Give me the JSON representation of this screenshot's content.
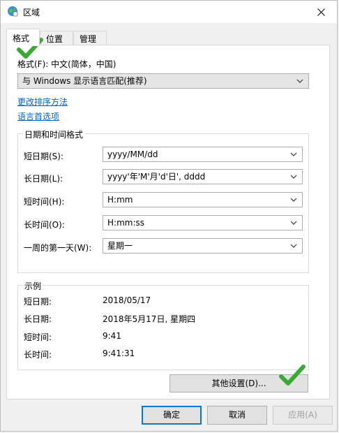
{
  "window": {
    "title": "区域"
  },
  "tabs": [
    {
      "label": "格式"
    },
    {
      "label": "位置"
    },
    {
      "label": "管理"
    }
  ],
  "format": {
    "label": "格式(F): 中文(简体，中国)",
    "selected": "与 Windows 显示语言匹配(推荐)"
  },
  "links": {
    "sort": "更改排序方法",
    "lang_pref": "语言首选项"
  },
  "datetime": {
    "group_title": "日期和时间格式",
    "rows": [
      {
        "label": "短日期(S):",
        "value": "yyyy/MM/dd"
      },
      {
        "label": "长日期(L):",
        "value": "yyyy'年'M'月'd'日', dddd"
      },
      {
        "label": "短时间(H):",
        "value": "H:mm"
      },
      {
        "label": "长时间(O):",
        "value": "H:mm:ss"
      },
      {
        "label": "一周的第一天(W):",
        "value": "星期一"
      }
    ]
  },
  "example": {
    "group_title": "示例",
    "rows": [
      {
        "label": "短日期:",
        "value": "2018/05/17"
      },
      {
        "label": "长日期:",
        "value": "2018年5月17日, 星期四"
      },
      {
        "label": "短时间:",
        "value": "9:41"
      },
      {
        "label": "长时间:",
        "value": "9:41:31"
      }
    ]
  },
  "buttons": {
    "more_settings": "其他设置(D)...",
    "ok": "确定",
    "cancel": "取消",
    "apply": "应用(A)"
  },
  "colors": {
    "accent": "#0078d7",
    "link": "#0066cc",
    "checkmark": "#3aa935"
  }
}
